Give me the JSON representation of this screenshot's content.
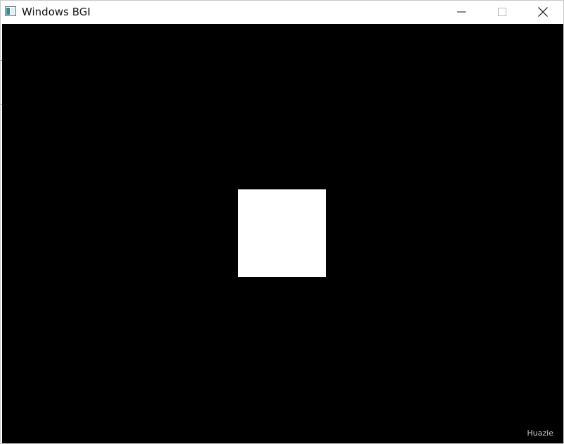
{
  "window": {
    "title": "Windows BGI",
    "app_icon": "bgi-window-icon"
  },
  "caption_buttons": {
    "minimize_icon": "minimize-icon",
    "maximize_icon": "maximize-icon",
    "close_icon": "close-icon"
  },
  "canvas": {
    "background_color": "#000000",
    "shape": {
      "kind": "filled-square",
      "color": "#ffffff"
    },
    "watermark": "Huazie"
  }
}
